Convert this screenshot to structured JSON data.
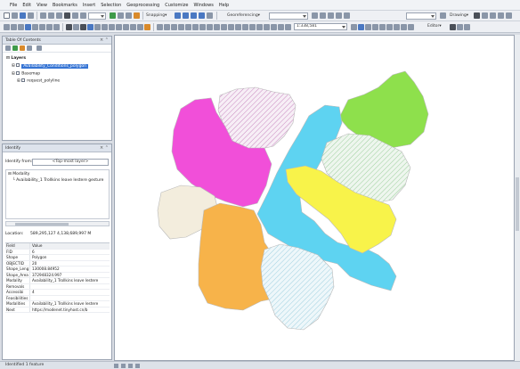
{
  "menu": [
    "File",
    "Edit",
    "View",
    "Bookmarks",
    "Insert",
    "Selection",
    "Geoprocessing",
    "Customize",
    "Windows",
    "Help"
  ],
  "toolbar1": {
    "scale_value": "",
    "snapping_label": "Snapping▾",
    "georef_label": "Georeferencing▾",
    "drawing_label": "Drawing▾"
  },
  "toolbar2": {
    "scale_combo": "1:338,581",
    "editor_label": "Editor▾"
  },
  "toc": {
    "title": "Table Of Contents",
    "layers_label": "Layers",
    "selected_layer": "Availability_Conditions_polygon",
    "basemap_label": "Basemap",
    "sublayer_label": "request_polyline"
  },
  "identify": {
    "title": "Identify",
    "from_label": "Identify from:",
    "from_value": "<Top-most layer>",
    "tree_root": "Modality",
    "tree_child": "Availability_1 Trollkins leave lestere gesture",
    "location_label": "Location:",
    "location_value": "589,295,127  4,138,689,997 M",
    "columns": [
      "Field",
      "Value"
    ],
    "rows": [
      [
        "FID",
        "6"
      ],
      [
        "Shape",
        "Polygon"
      ],
      [
        "OBJECTID",
        "20"
      ],
      [
        "Shape_Leng",
        "130008.84952"
      ],
      [
        "Shape_Area",
        "372948324.997"
      ],
      [
        "Modality",
        "Availability_1 Trollkins leave lestere"
      ],
      [
        "Removals",
        ""
      ],
      [
        "Accessibi",
        "4"
      ],
      [
        "Feasibilities",
        ""
      ],
      [
        "Modalities",
        "Availability_1 Trollkins leave lestere"
      ],
      [
        "Next",
        "https://modenet.tinyhost.cn/b"
      ]
    ]
  },
  "status": {
    "text": "Identified 1 feature"
  },
  "map_colors": {
    "magenta": "#f14fd9",
    "lime": "#8ee04c",
    "cyan": "#5ed3f1",
    "yellow": "#f8f34a",
    "orange": "#f7b34a",
    "cream": "#f3eddd",
    "hatch_pink": "#c88ac0",
    "hatch_green": "#9ecf9e",
    "hatch_blue": "#9fd0e0"
  }
}
